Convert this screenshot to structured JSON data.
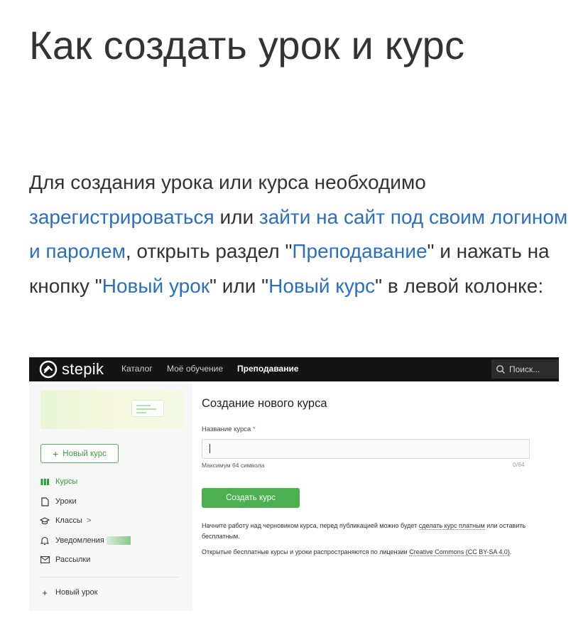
{
  "article": {
    "title": "Как создать урок и курс",
    "intro": {
      "t1": "Для создания урока или курса необходимо ",
      "link_register": "зарегистрироваться",
      "t2": " или ",
      "link_login": "зайти на сайт под своим логином и паролем",
      "t3": ", открыть раздел \"",
      "link_teaching": "Преподавание",
      "t4": "\" и нажать на кнопку \"",
      "link_new_lesson": "Новый урок",
      "t5": "\" или \"",
      "link_new_course": "Новый курс",
      "t6": "\" в левой колонке:"
    }
  },
  "screenshot": {
    "topbar": {
      "logo_text": "stepik",
      "nav": [
        "Каталог",
        "Моё обучение",
        "Преподавание"
      ],
      "active_nav": "Преподавание",
      "search_placeholder": "Поиск..."
    },
    "sidebar": {
      "new_course_button": "Новый курс",
      "items": [
        {
          "label": "Курсы",
          "icon": "books-icon"
        },
        {
          "label": "Уроки",
          "icon": "document-icon"
        },
        {
          "label": "Классы",
          "icon": "graduation-cap-icon"
        },
        {
          "label": "Уведомления",
          "icon": "bell-icon"
        },
        {
          "label": "Рассылки",
          "icon": "mail-icon"
        }
      ],
      "classes_chevron": ">",
      "new_lesson_label": "Новый урок"
    },
    "form": {
      "title": "Создание нового курса",
      "field_label": "Название курса",
      "required_mark": "*",
      "input_value": "",
      "hint": "Максимум 64 символа",
      "counter": "0/64",
      "submit_label": "Создать курс",
      "notice1_a": "Начните работу над черновиком курса, перед публикацией можно будет ",
      "notice1_link": "сделать курс платным",
      "notice1_b": " или оставить бесплатным.",
      "notice2_a": "Открытые бесплатные курсы и уроки распространяются по лицензии ",
      "notice2_link": "Creative Commons (CC BY-SA 4.0)",
      "notice2_b": "."
    }
  },
  "colors": {
    "link": "#2a6fc0",
    "topbar_bg": "#141414",
    "accent_green": "#4caf50"
  }
}
